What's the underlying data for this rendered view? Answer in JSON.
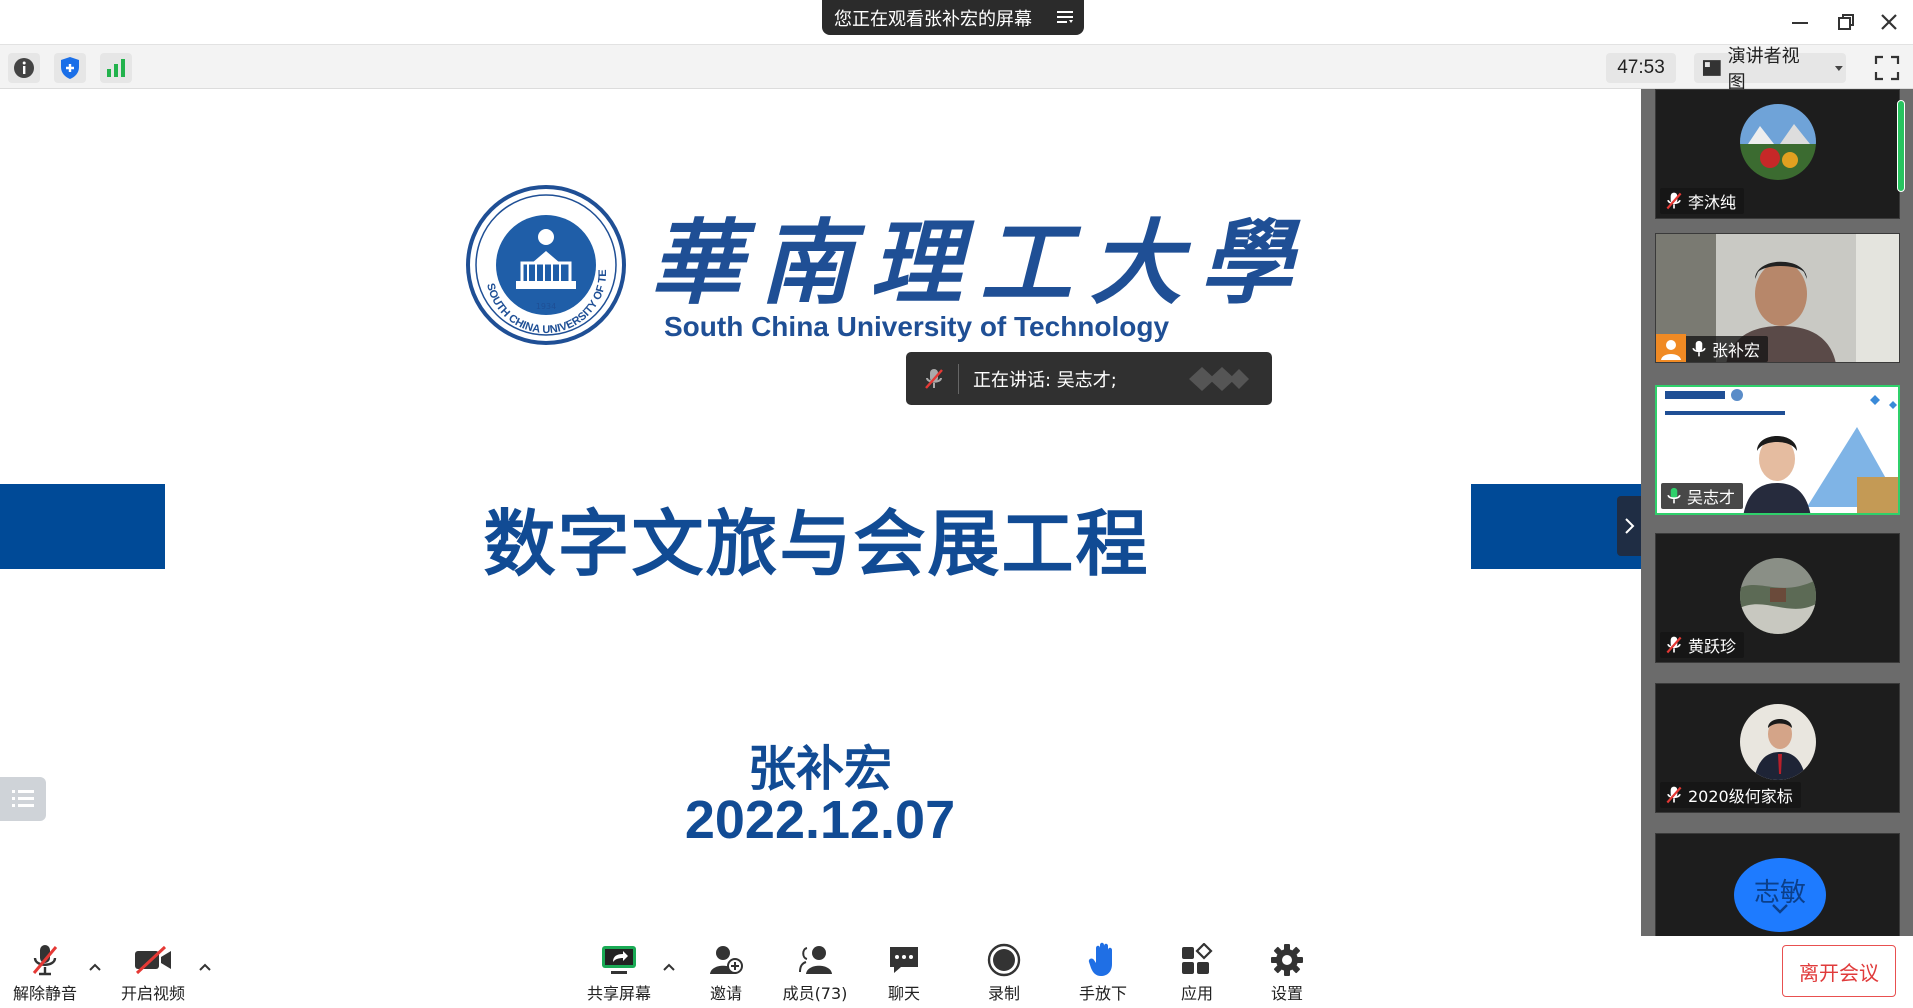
{
  "titlebar": {
    "share_notice": "您正在观看张补宏的屏幕",
    "icons": [
      "minimize-icon",
      "restore-icon",
      "close-icon"
    ]
  },
  "statusbar": {
    "icons": [
      "info-icon",
      "shield-icon",
      "signal-icon"
    ],
    "timer": "47:53",
    "view_label": "演讲者视图",
    "fullscreen_icon": "fullscreen-icon"
  },
  "slide": {
    "university_cn": "華南理工大學",
    "university_en": "South China University of Technology",
    "seal_year": "1934",
    "title": "数字文旅与会展工程",
    "author": "张补宏",
    "date": "2022.12.07",
    "accent_color": "#004a97"
  },
  "speaking": {
    "text": "正在讲话: 吴志才;"
  },
  "participants": [
    {
      "name": "李沐纯",
      "muted": true
    },
    {
      "name": "张补宏",
      "muted": false
    },
    {
      "name": "吴志才",
      "muted": false,
      "active": true
    },
    {
      "name": "黄跃珍",
      "muted": true
    },
    {
      "name": "2020级何家标",
      "muted": true
    },
    {
      "name": "志敏"
    }
  ],
  "toolbar": {
    "unmute": "解除静音",
    "start_video": "开启视频",
    "share_screen": "共享屏幕",
    "invite": "邀请",
    "members": "成员(73)",
    "chat": "聊天",
    "record": "录制",
    "hand_down": "手放下",
    "apps": "应用",
    "settings": "设置",
    "leave": "离开会议"
  }
}
